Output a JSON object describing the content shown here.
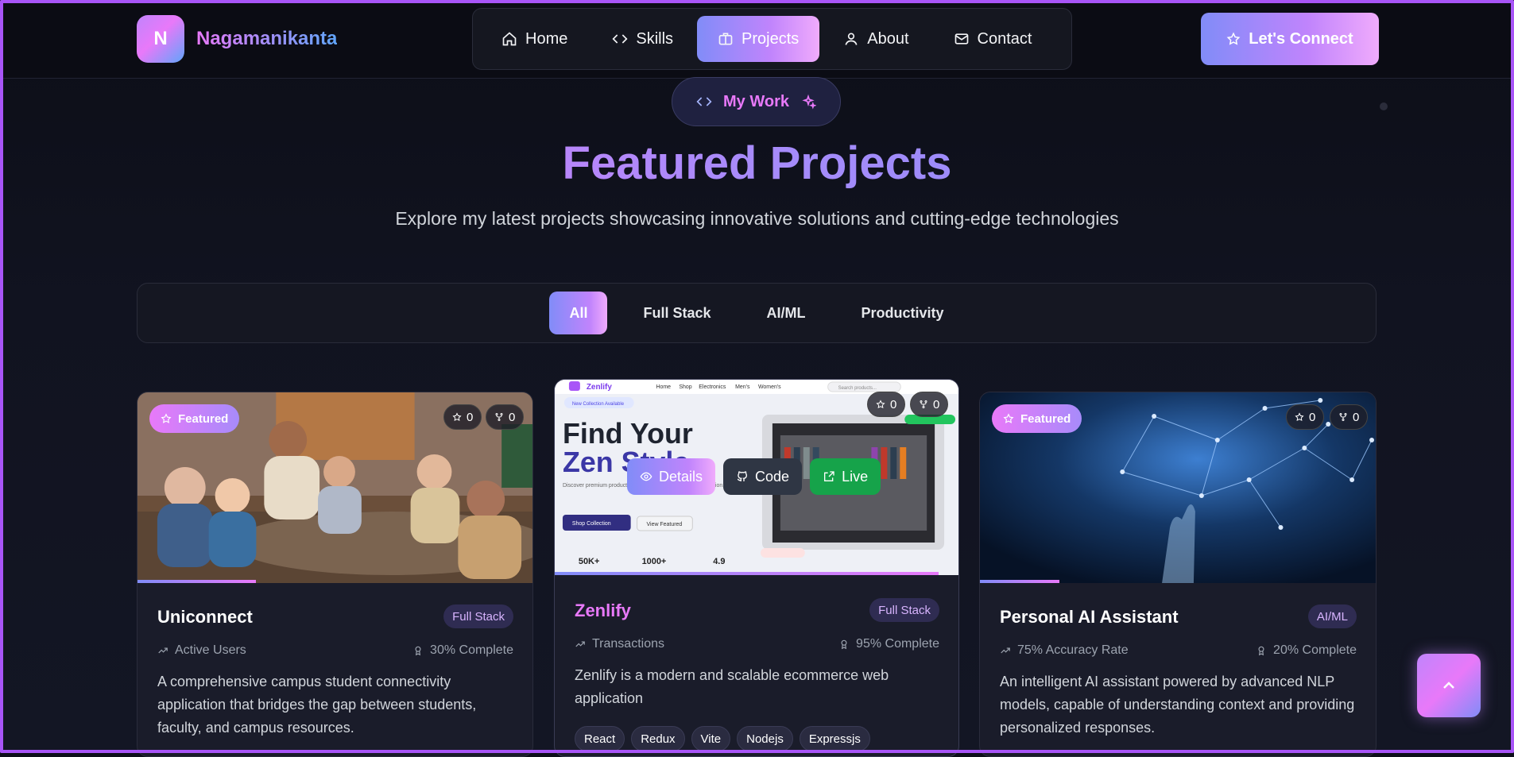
{
  "brand": {
    "initial": "N",
    "name": "Nagamanikanta"
  },
  "nav": {
    "items": [
      {
        "label": "Home",
        "icon": "home-icon"
      },
      {
        "label": "Skills",
        "icon": "code-icon"
      },
      {
        "label": "Projects",
        "icon": "briefcase-icon",
        "active": true
      },
      {
        "label": "About",
        "icon": "user-icon"
      },
      {
        "label": "Contact",
        "icon": "mail-icon"
      }
    ],
    "cta": "Let's Connect"
  },
  "section": {
    "badge": "My Work",
    "title": "Featured Projects",
    "subtitle": "Explore my latest projects showcasing innovative solutions and cutting-edge technologies"
  },
  "filters": [
    "All",
    "Full Stack",
    "AI/ML",
    "Productivity"
  ],
  "active_filter": "All",
  "projects": [
    {
      "title": "Uniconnect",
      "category": "Full Stack",
      "featured": "Featured",
      "stars": "0",
      "forks": "0",
      "metric": "Active Users",
      "completion": "30% Complete",
      "completion_value": 30,
      "description": "A comprehensive campus student connectivity application that bridges the gap between students, faculty, and campus resources."
    },
    {
      "title": "Zenlify",
      "category": "Full Stack",
      "stars": "0",
      "forks": "0",
      "metric": "Transactions",
      "completion": "95% Complete",
      "completion_value": 95,
      "description": "Zenlify is a modern and scalable ecommerce web application",
      "tech": [
        "React",
        "Redux",
        "Vite",
        "Nodejs",
        "Expressjs"
      ],
      "actions": {
        "details": "Details",
        "code": "Code",
        "live": "Live"
      },
      "preview": {
        "logo": "Zenlify",
        "menu": [
          "Home",
          "Shop",
          "Electronics",
          "Men's",
          "Women's"
        ],
        "search": "Search products...",
        "pill": "New Collection Available",
        "headline1": "Find Your",
        "headline2": "Zen Style",
        "body": "Discover premium products... lifestyle. Shop mindfully... collection.",
        "btn1": "Shop Collection",
        "btn2": "View Featured",
        "stats": [
          "50K+",
          "1000+",
          "4.9"
        ]
      }
    },
    {
      "title": "Personal AI Assistant",
      "category": "AI/ML",
      "featured": "Featured",
      "stars": "0",
      "forks": "0",
      "metric": "75% Accuracy Rate",
      "completion": "20% Complete",
      "completion_value": 20,
      "description": "An intelligent AI assistant powered by advanced NLP models, capable of understanding context and providing personalized responses."
    }
  ],
  "colors": {
    "accent": "#c084fc",
    "frame": "#a855f7",
    "live": "#16a34a"
  }
}
